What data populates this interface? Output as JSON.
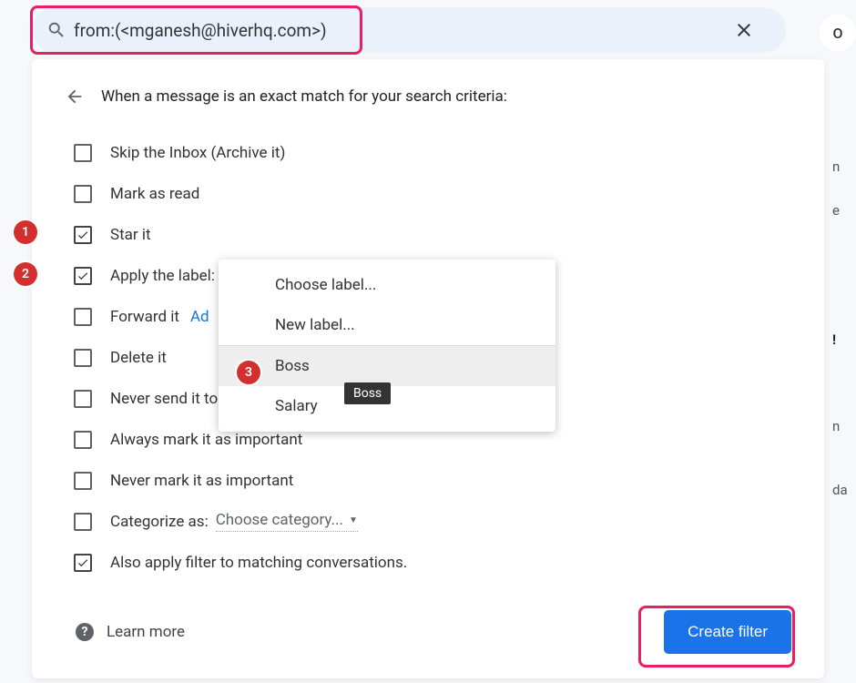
{
  "search": {
    "query": "from:(<mganesh@hiverhq.com>)"
  },
  "avatar": "O",
  "header": "When a message is an exact match for your search criteria:",
  "options": {
    "skip_inbox": "Skip the Inbox (Archive it)",
    "mark_read": "Mark as read",
    "star_it": "Star it",
    "apply_label": "Apply the label:",
    "forward_it": "Forward it",
    "forward_add": "Ad",
    "delete_it": "Delete it",
    "never_spam": "Never send it to S",
    "always_important": "Always mark it as important",
    "never_important": "Never mark it as important",
    "categorize_as": "Categorize as:",
    "categorize_placeholder": "Choose category...",
    "also_apply": "Also apply filter to matching conversations."
  },
  "dropdown": {
    "choose": "Choose label...",
    "new": "New label...",
    "boss": "Boss",
    "salary": "Salary"
  },
  "tooltip": "Boss",
  "footer": {
    "learn_more": "Learn more",
    "create": "Create filter"
  },
  "annotations": {
    "a1": "1",
    "a2": "2",
    "a3": "3"
  },
  "bg_chars": {
    "r1": "n",
    "r2": "e",
    "r3": "!",
    "r4": "n",
    "r5": "da"
  }
}
